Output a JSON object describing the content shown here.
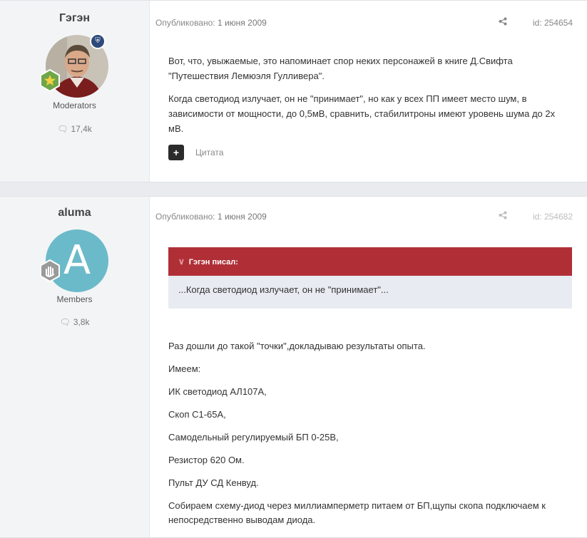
{
  "colors": {
    "quote_header": "#b02f37",
    "mod_badge": "#2e4a7a",
    "rank_badge": "#6fa64a",
    "avatar_letter_bg": "#6bbac9"
  },
  "posts": [
    {
      "author": "Гэгэн",
      "group": "Moderators",
      "post_count": "17,4k",
      "date_label": "Опубликовано:",
      "date": "1 июня 2009",
      "post_id": "id: 254654",
      "icons": [
        "share-icon",
        "moderator-shield-icon",
        "rank-star-icon",
        "comment-bubble-icon"
      ],
      "paragraphs": [
        "Вот, что, увыжаемые, это напоминает спор неких персонажей в книге Д.Свифта \"Путешествия Лемюэля Гулливера\".",
        "Когда светодиод излучает, он не \"принимает\", но как у всех ПП имеет место шум, в зависимости от мощности, до 0,5мВ, сравнить, стабилитроны имеют уровень шума до 2х мВ."
      ],
      "quote_button": "+",
      "quote_label": "Цитата"
    },
    {
      "author": "aluma",
      "group": "Members",
      "post_count": "3,8k",
      "avatar_letter": "A",
      "date_label": "Опубликовано:",
      "date": "1 июня 2009",
      "post_id": "id: 254682",
      "icons": [
        "share-icon",
        "rank-hand-icon",
        "comment-bubble-icon"
      ],
      "quote": {
        "header": "Гэгэн писал:",
        "text": "...Когда светодиод излучает, он не \"принимает\"..."
      },
      "paragraphs": [
        "Раз дошли до такой \"точки\",докладываю результаты опыта.",
        "Имеем:",
        "ИК светодиод АЛ107А,",
        "Скоп С1-65А,",
        "Самодельный регулируемый БП 0-25В,",
        "Резистор 620 Ом.",
        "Пульт ДУ СД Кенвуд.",
        "Собираем схему-диод через миллиамперметр питаем от БП,щупы скопа подключаем к непосредственно выводам диода."
      ]
    }
  ]
}
